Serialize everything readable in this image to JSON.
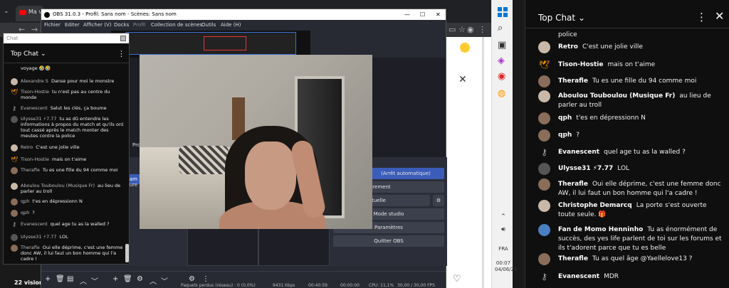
{
  "browser": {
    "tab_title": "Ma vi",
    "views": "22 visionn"
  },
  "youtube_page": {
    "close": "✕",
    "side_text": "out\ncentre la",
    "heart": "♡"
  },
  "taskbar": {
    "time": "00:07",
    "date": "04/06/25",
    "lang": "FRA"
  },
  "obs": {
    "title": "OBS 31.0.3 - Profil: Sans nom - Scènes: Sans nom",
    "menu": [
      "Fichier",
      "Editer",
      "Afficher (V)",
      "Docks",
      "Profil",
      "Collection de scènes",
      "Outils",
      "Aide (H)"
    ],
    "controls": {
      "streaming": "aming",
      "stop_auto": "(Arrêt automatique)",
      "record": "rrer l'enregistrement",
      "virtual_cam": "la caméra virtuelle",
      "studio_mode": "Mode studio",
      "settings": "Paramètres",
      "quit": "Quitter OBS"
    },
    "side_labels": {
      "pro": "Pro",
      "cam": "cam",
      "ture": "ture"
    },
    "status": {
      "dropped": "Paquets perdus (réseau) : 0 (0,0%)",
      "bitrate": "9431 kbps",
      "time1": "00:40:59",
      "time2": "00:00:00",
      "cpu": "CPU: 11,1%",
      "fps": "30,00 / 30,00 FPS"
    }
  },
  "popup_chat": {
    "window_label": "Chat",
    "title": "Top Chat",
    "messages": [
      {
        "author": "",
        "text": "voyage 🤣🤣",
        "avatar": "none"
      },
      {
        "author": "Alexandre S",
        "text": "Danse pour moi le monstre",
        "avatar": "pale"
      },
      {
        "author": "Tison-Hostie",
        "text": "tu n'est pas au centre du monde",
        "avatar": "bird"
      },
      {
        "author": "Evanescent",
        "text": "Salut les clés, ça boume",
        "avatar": "key"
      },
      {
        "author": "Ulysse31 ⚡7.77",
        "text": "tu as dû entendre les informations à propos du match et qu'ils ont tout cassé après le match monter des meutes contre la police",
        "avatar": "dark"
      },
      {
        "author": "Retro",
        "text": "C'est une jolie ville",
        "avatar": "pale"
      },
      {
        "author": "Tison-Hostie",
        "text": "mais on t'aime",
        "avatar": "bird"
      },
      {
        "author": "Therafle",
        "text": "Tu es une fille du 94 comme moi",
        "avatar": "brown"
      },
      {
        "author": "Aboulou Touboulou (Musique Fr)",
        "text": "au lieu de parler au troll",
        "avatar": "pale"
      },
      {
        "author": "qph",
        "text": "t'es en dépressionn N",
        "avatar": "brown"
      },
      {
        "author": "qph",
        "text": "?",
        "avatar": "brown"
      },
      {
        "author": "Evanescent",
        "text": "quel age tu as la walled ?",
        "avatar": "key"
      },
      {
        "author": "Ulysse31 ⚡7.77",
        "text": "LOL",
        "avatar": "dark"
      },
      {
        "author": "Therafle",
        "text": "Oui elle déprime, c'est une femme donc AW, il lui faut un bon homme qui l'a cadre !",
        "avatar": "brown"
      }
    ]
  },
  "chat": {
    "title": "Top Chat",
    "messages": [
      {
        "author": "",
        "text": "police",
        "avatar": "none"
      },
      {
        "author": "Retro",
        "text": "C'est une jolie ville",
        "avatar": "pale"
      },
      {
        "author": "Tison-Hostie",
        "text": "mais on t'aime",
        "avatar": "bird"
      },
      {
        "author": "Therafle",
        "text": "Tu es une fille du 94 comme moi",
        "avatar": "brown"
      },
      {
        "author": "Aboulou Touboulou (Musique Fr)",
        "text": "au lieu de parler au troll",
        "avatar": "pale"
      },
      {
        "author": "qph",
        "text": "t'es en dépressionn N",
        "avatar": "brown"
      },
      {
        "author": "qph",
        "text": "?",
        "avatar": "brown"
      },
      {
        "author": "Evanescent",
        "text": "quel age tu as la walled ?",
        "avatar": "key"
      },
      {
        "author": "Ulysse31 ⚡7.77",
        "text": "LOL",
        "avatar": "dark"
      },
      {
        "author": "Therafle",
        "text": "Oui elle déprime, c'est une femme donc AW, il lui faut un bon homme qui l'a cadre !",
        "avatar": "brown"
      },
      {
        "author": "Christophe Demarcq",
        "text": "La porte s'est ouverte toute seule. 🎁",
        "avatar": "pale"
      },
      {
        "author": "Fan de Momo Henninho",
        "text": "Tu as énormément de succès, des yes life parlent de toi sur les forums et ils t'adorent parce que tu es belle",
        "avatar": "blue"
      },
      {
        "author": "Therafle",
        "text": "Tu as quel âge @Yaellelove13 ?",
        "avatar": "brown"
      },
      {
        "author": "Evanescent",
        "text": "MDR",
        "avatar": "key"
      }
    ]
  }
}
